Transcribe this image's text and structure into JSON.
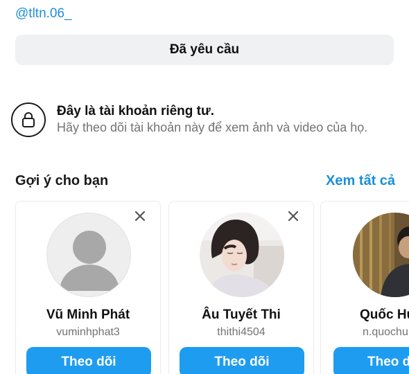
{
  "profile": {
    "handle": "@tltn.06_",
    "request_status_label": "Đã yêu cầu"
  },
  "private_notice": {
    "icon": "lock-icon",
    "title": "Đây là tài khoản riêng tư.",
    "description": "Hãy theo dõi tài khoản này để xem ảnh và video của họ."
  },
  "suggestions": {
    "title": "Gợi ý cho bạn",
    "see_all_label": "Xem tất cả",
    "cards": [
      {
        "name": "Vũ Minh Phát",
        "username": "vuminhphat3",
        "follow_label": "Theo dõi",
        "avatar": "default-avatar-icon"
      },
      {
        "name": "Âu Tuyết Thi",
        "username": "thithi4504",
        "follow_label": "Theo dõi",
        "avatar": "profile-photo"
      },
      {
        "name": "Quốc Hu",
        "username": "n.quochu",
        "follow_label": "Theo d",
        "avatar": "profile-photo"
      }
    ]
  },
  "colors": {
    "accent": "#1e9cf0",
    "link": "#1a8fd8",
    "secondary_text": "#737373",
    "button_gray": "#f0f1f3"
  }
}
